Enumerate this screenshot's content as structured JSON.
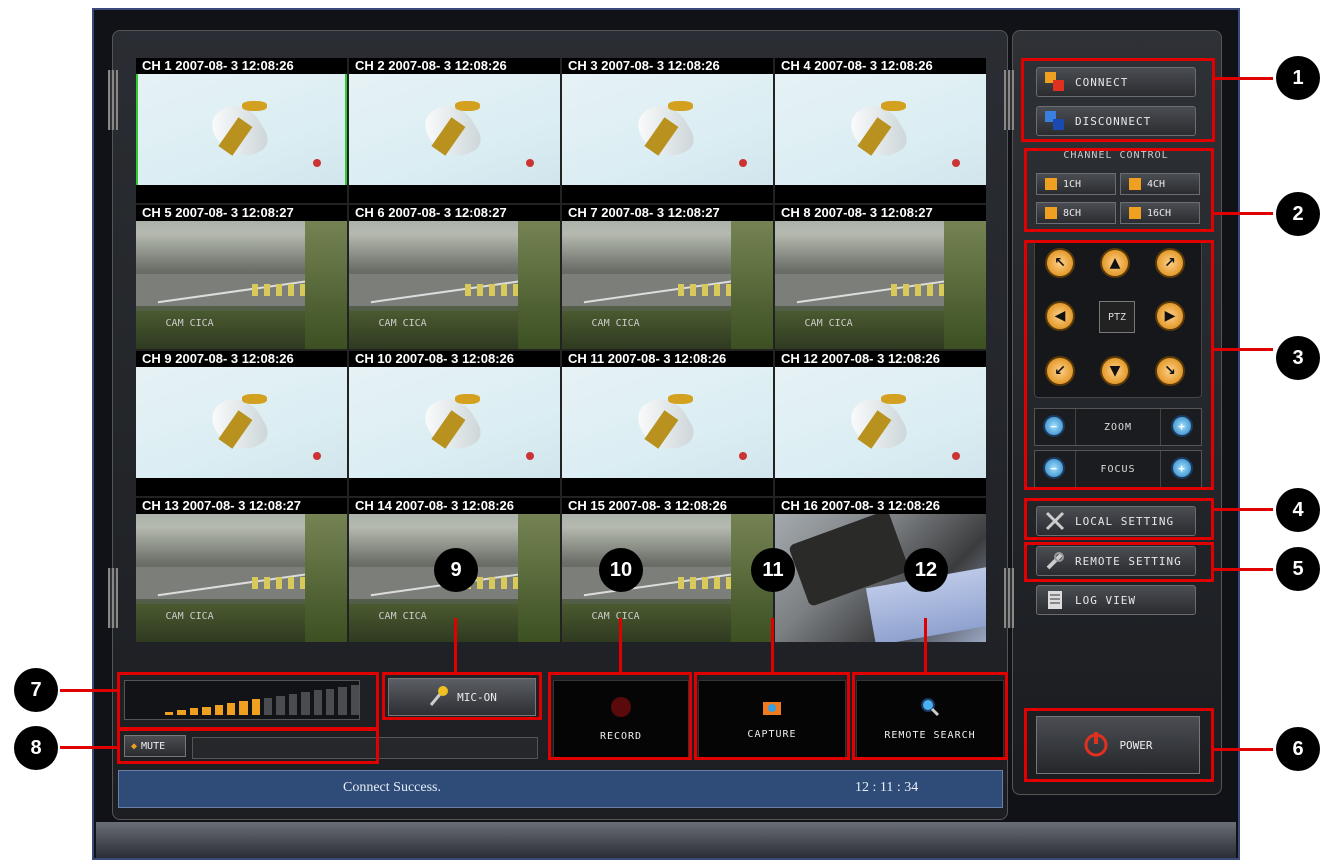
{
  "channels": [
    {
      "label": "CH 1 2007-08- 3 12:08:26",
      "view": "a"
    },
    {
      "label": "CH 2 2007-08- 3 12:08:26",
      "view": "a"
    },
    {
      "label": "CH 3 2007-08- 3 12:08:26",
      "view": "a"
    },
    {
      "label": "CH 4 2007-08- 3 12:08:26",
      "view": "a"
    },
    {
      "label": "CH 5 2007-08- 3 12:08:27",
      "view": "b"
    },
    {
      "label": "CH 6 2007-08- 3 12:08:27",
      "view": "b"
    },
    {
      "label": "CH 7 2007-08- 3 12:08:27",
      "view": "b"
    },
    {
      "label": "CH 8 2007-08- 3 12:08:27",
      "view": "b"
    },
    {
      "label": "CH 9 2007-08- 3 12:08:26",
      "view": "a"
    },
    {
      "label": "CH 10 2007-08- 3 12:08:26",
      "view": "a"
    },
    {
      "label": "CH 11 2007-08- 3 12:08:26",
      "view": "a"
    },
    {
      "label": "CH 12 2007-08- 3 12:08:26",
      "view": "a"
    },
    {
      "label": "CH 13 2007-08- 3 12:08:27",
      "view": "b"
    },
    {
      "label": "CH 14 2007-08- 3 12:08:26",
      "view": "b"
    },
    {
      "label": "CH 15 2007-08- 3 12:08:26",
      "view": "b"
    },
    {
      "label": "CH 16 2007-08- 3 12:08:26",
      "view": "c"
    }
  ],
  "selected_channel": 1,
  "camera_caption": "CAM CICA",
  "connection": {
    "connect_label": "CONNECT",
    "disconnect_label": "DISCONNECT"
  },
  "channel_control": {
    "title": "CHANNEL CONTROL",
    "buttons": [
      "1CH",
      "4CH",
      "8CH",
      "16CH"
    ]
  },
  "ptz": {
    "center_label": "PTZ",
    "zoom_label": "ZOOM",
    "focus_label": "FOCUS",
    "arrows": [
      "arrow-up-left",
      "arrow-up",
      "arrow-up-right",
      "arrow-left",
      "arrow-right",
      "arrow-down-left",
      "arrow-down",
      "arrow-down-right"
    ]
  },
  "settings": {
    "local": "LOCAL SETTING",
    "remote": "REMOTE SETTING",
    "log": "LOG VIEW"
  },
  "power_label": "POWER",
  "audio": {
    "mic_label": "MIC-ON",
    "mute_label": "MUTE",
    "volume_level": 0.5
  },
  "actions": {
    "record": "RECORD",
    "capture": "CAPTURE",
    "remote_search": "REMOTE SEARCH"
  },
  "status": {
    "message": "Connect Success.",
    "clock": "12 : 11 : 34"
  },
  "callouts": [
    "1",
    "2",
    "3",
    "4",
    "5",
    "6",
    "7",
    "8",
    "9",
    "10",
    "11",
    "12"
  ],
  "colors": {
    "highlight": "#e00000",
    "selected_channel": "#2ecc2e",
    "status_bar": "#2f4c78",
    "accent_orange": "#f0a020"
  }
}
